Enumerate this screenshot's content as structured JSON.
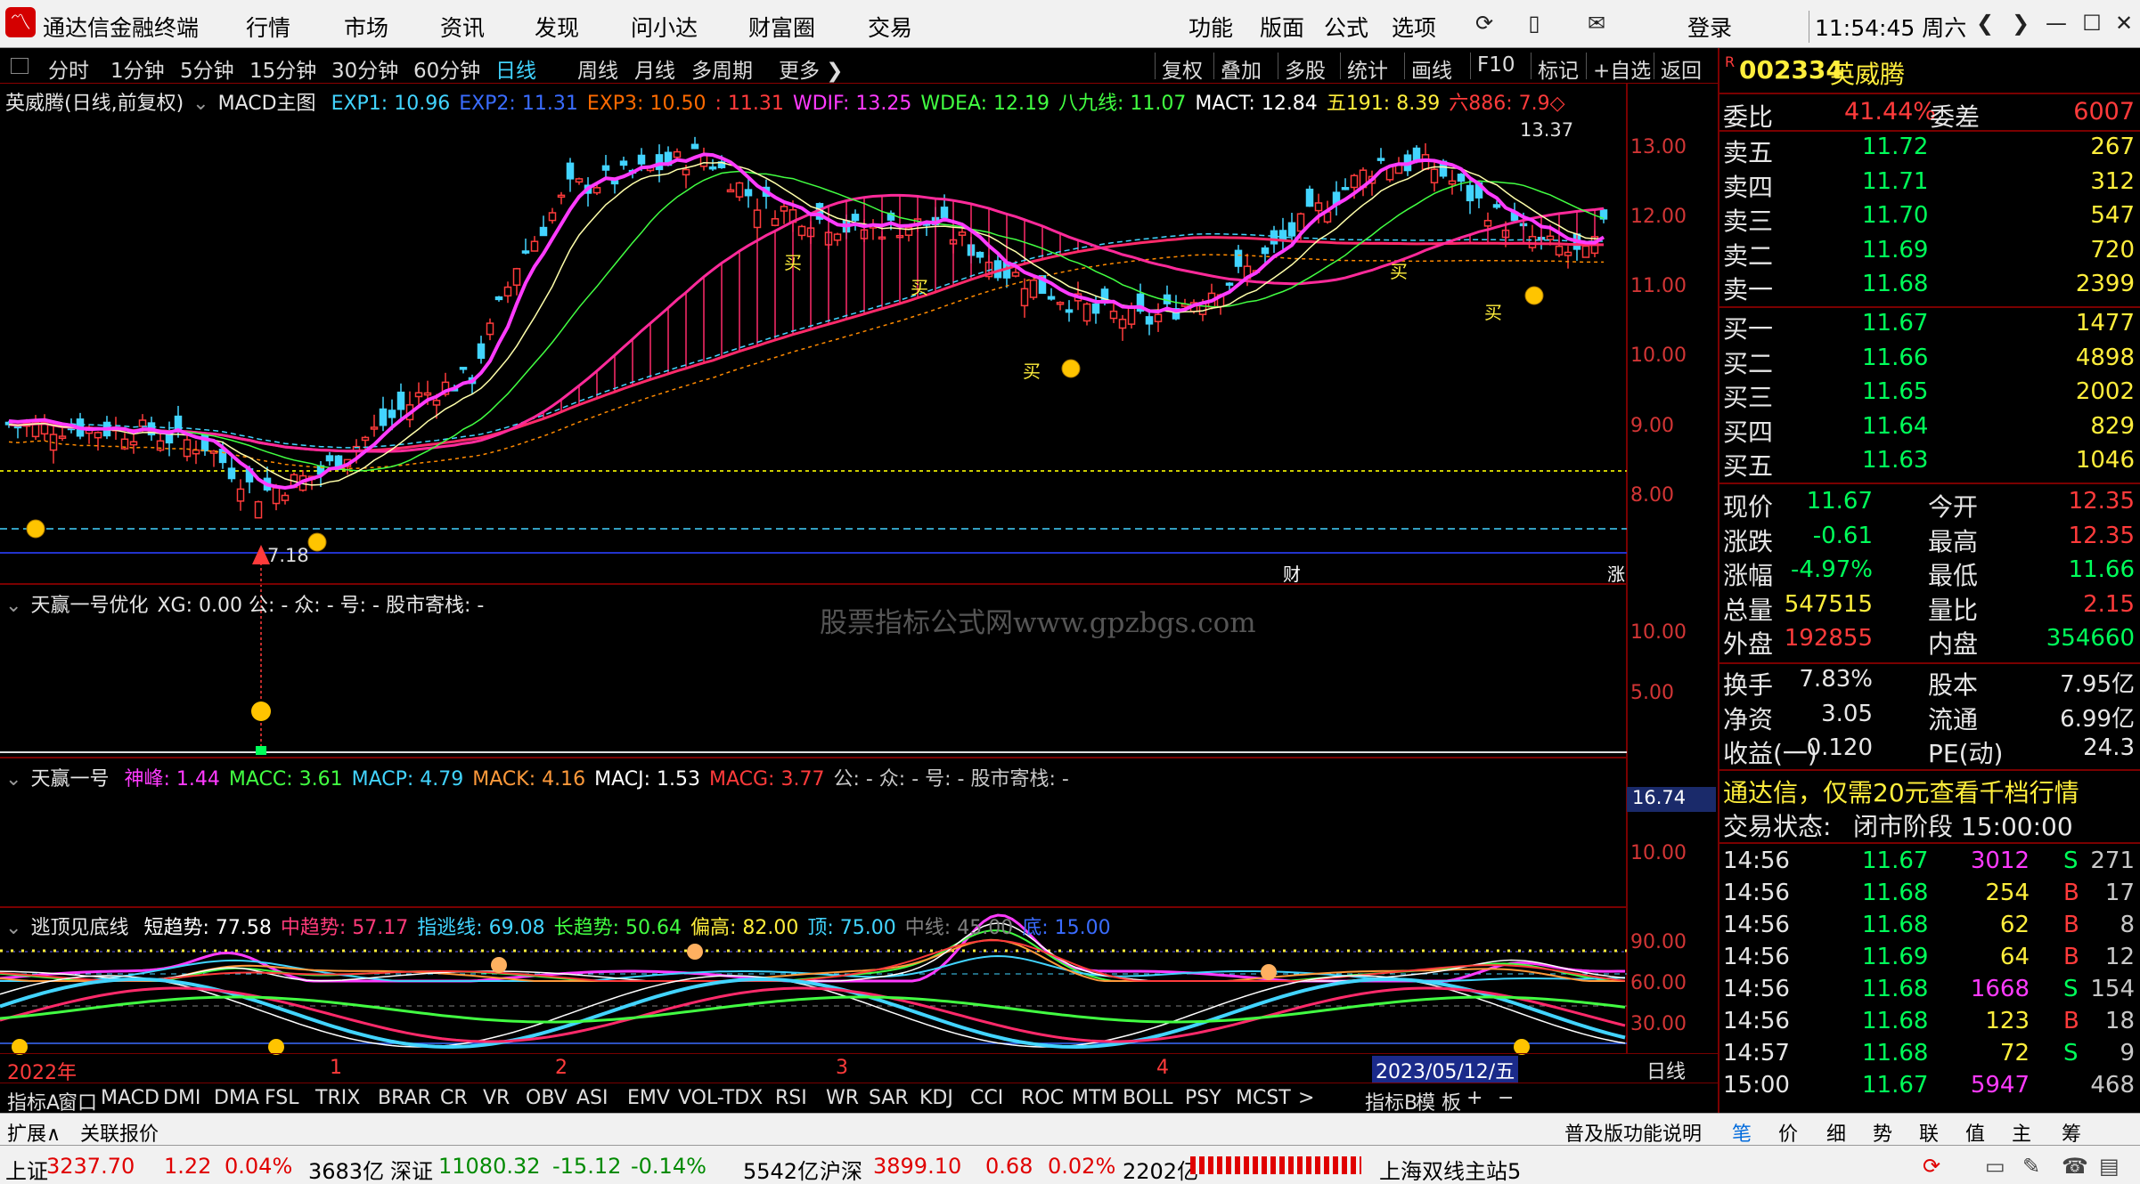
{
  "app": {
    "title": "通达信金融终端",
    "menu": [
      "行情",
      "市场",
      "资讯",
      "发现",
      "问小达",
      "财富圈",
      "交易"
    ],
    "right_menu": [
      "功能",
      "版面",
      "公式",
      "选项"
    ],
    "login": "登录",
    "clock": "11:54:45 周六"
  },
  "periods": [
    "分时",
    "1分钟",
    "5分钟",
    "15分钟",
    "30分钟",
    "60分钟",
    "日线",
    "周线",
    "月线",
    "多周期",
    "更多 ❯"
  ],
  "tools": [
    "复权",
    "叠加",
    "多股",
    "统计",
    "画线",
    "F10",
    "标记",
    "+自选",
    "返回"
  ],
  "main": {
    "title": "英威腾(日线,前复权)",
    "indicator": "MACD主图",
    "params": [
      {
        "t": "EXP1: 10.96",
        "c": "#42d4ff"
      },
      {
        "t": "EXP2: 11.31",
        "c": "#3a6cff"
      },
      {
        "t": "EXP3: 10.50",
        "c": "#ff6a00"
      },
      {
        "t": ": 11.31",
        "c": "#ff3b3b"
      },
      {
        "t": "WDIF: 13.25",
        "c": "#ff3bff"
      },
      {
        "t": "WDEA: 12.19",
        "c": "#42ff42"
      },
      {
        "t": "八九线: 11.07",
        "c": "#42ff42"
      },
      {
        "t": "MACT: 12.84",
        "c": "#ffffff"
      },
      {
        "t": "五191: 8.39",
        "c": "#ffee3c"
      },
      {
        "t": "六886: 7.9◇",
        "c": "#ff3b3b"
      }
    ],
    "y_labels": [
      "13.00",
      "12.00",
      "11.00",
      "10.00",
      "9.00",
      "8.00"
    ],
    "high_label": "13.37",
    "low_label": "7.18",
    "mark1": "财",
    "mark2": "涨",
    "buy": "买"
  },
  "sub1": {
    "title": "天赢一号优化",
    "params": "XG: 0.00 公: - 众: - 号: - 股市寄栈: -",
    "y_labels": [
      "10.00",
      "5.00"
    ],
    "watermark": "股票指标公式网www.gpzbgs.com"
  },
  "sub2": {
    "title": "天赢一号",
    "params": [
      {
        "t": "神峰: 1.44",
        "c": "#ff3bff"
      },
      {
        "t": "MACC: 3.61",
        "c": "#42ff42"
      },
      {
        "t": "MACP: 4.79",
        "c": "#42d4ff"
      },
      {
        "t": "MACK: 4.16",
        "c": "#ff9a3b"
      },
      {
        "t": "MACJ: 1.53",
        "c": "#ffffff"
      },
      {
        "t": "MACG: 3.77",
        "c": "#ff3b3b"
      },
      {
        "t": "公: - 众: - 号: - 股市寄栈: -",
        "c": "#c8c8c8"
      }
    ],
    "y_labels": [
      "16.74",
      "10.00"
    ]
  },
  "sub3": {
    "title": "逃顶见底线",
    "params": [
      {
        "t": "短趋势: 77.58",
        "c": "#ffffff"
      },
      {
        "t": "中趋势: 57.17",
        "c": "#ff3b7a"
      },
      {
        "t": "指逃线: 69.08",
        "c": "#42d4ff"
      },
      {
        "t": "长趋势: 50.64",
        "c": "#42ff42"
      },
      {
        "t": "偏高: 82.00",
        "c": "#ffee3c"
      },
      {
        "t": "顶: 75.00",
        "c": "#42d4ff"
      },
      {
        "t": "中线: 45.00",
        "c": "#808080"
      },
      {
        "t": "底: 15.00",
        "c": "#3a6cff"
      }
    ],
    "y_labels": [
      "90.00",
      "60.00",
      "30.00"
    ]
  },
  "xaxis": {
    "labels": [
      "2022年",
      "1",
      "2",
      "3",
      "4"
    ],
    "date": "2023/05/12/五",
    "period": "日线"
  },
  "tabs": [
    "指标A",
    "窗口",
    "MACD",
    "DMI",
    "DMA",
    "FSL",
    "TRIX",
    "BRAR",
    "CR",
    "VR",
    "OBV",
    "ASI",
    "EMV",
    "VOL-TDX",
    "RSI",
    "WR",
    "SAR",
    "KDJ",
    "CCI",
    "ROC",
    "MTM",
    "BOLL",
    "PSY",
    "MCST",
    ">",
    "指标B",
    "模 板",
    "+",
    "−"
  ],
  "bottom": {
    "left": [
      "扩展∧",
      "关联报价"
    ],
    "right": [
      "普及版功能说明",
      "笔",
      "价",
      "细",
      "势",
      "联",
      "值",
      "主",
      "筹"
    ]
  },
  "quote": {
    "code": "002334",
    "name": "英威腾",
    "wb_label": "委比",
    "wb": "41.44%",
    "wc_label": "委差",
    "wc": "6007",
    "asks": [
      {
        "l": "卖五",
        "p": "11.72",
        "v": "267"
      },
      {
        "l": "卖四",
        "p": "11.71",
        "v": "312"
      },
      {
        "l": "卖三",
        "p": "11.70",
        "v": "547"
      },
      {
        "l": "卖二",
        "p": "11.69",
        "v": "720"
      },
      {
        "l": "卖一",
        "p": "11.68",
        "v": "2399"
      }
    ],
    "bids": [
      {
        "l": "买一",
        "p": "11.67",
        "v": "1477"
      },
      {
        "l": "买二",
        "p": "11.66",
        "v": "4898"
      },
      {
        "l": "买三",
        "p": "11.65",
        "v": "2002"
      },
      {
        "l": "买四",
        "p": "11.64",
        "v": "829"
      },
      {
        "l": "买五",
        "p": "11.63",
        "v": "1046"
      }
    ],
    "stats": [
      {
        "l1": "现价",
        "v1": "11.67",
        "c1": "green",
        "l2": "今开",
        "v2": "12.35",
        "c2": "red"
      },
      {
        "l1": "涨跌",
        "v1": "-0.61",
        "c1": "green",
        "l2": "最高",
        "v2": "12.35",
        "c2": "red"
      },
      {
        "l1": "涨幅",
        "v1": "-4.97%",
        "c1": "green",
        "l2": "最低",
        "v2": "11.66",
        "c2": "green"
      },
      {
        "l1": "总量",
        "v1": "547515",
        "c1": "yellow",
        "l2": "量比",
        "v2": "2.15",
        "c2": "red"
      },
      {
        "l1": "外盘",
        "v1": "192855",
        "c1": "red",
        "l2": "内盘",
        "v2": "354660",
        "c2": "green"
      }
    ],
    "stats2": [
      {
        "l1": "换手",
        "v1": "7.83%",
        "l2": "股本",
        "v2": "7.95亿"
      },
      {
        "l1": "净资",
        "v1": "3.05",
        "l2": "流通",
        "v2": "6.99亿"
      },
      {
        "l1": "收益(一)",
        "v1": "0.120",
        "l2": "PE(动)",
        "v2": "24.3"
      }
    ],
    "ad": "通达信，仅需20元查看千档行情",
    "state_label": "交易状态:",
    "state": "闭市阶段 15:00:00",
    "ticks": [
      {
        "t": "14:56",
        "p": "11.67",
        "v": "3012",
        "vc": "magenta",
        "bs": "S",
        "n": "271"
      },
      {
        "t": "14:56",
        "p": "11.68",
        "v": "254",
        "vc": "yellow",
        "bs": "B",
        "n": "17"
      },
      {
        "t": "14:56",
        "p": "11.68",
        "v": "62",
        "vc": "yellow",
        "bs": "B",
        "n": "8"
      },
      {
        "t": "14:56",
        "p": "11.69",
        "v": "64",
        "vc": "yellow",
        "bs": "B",
        "n": "12"
      },
      {
        "t": "14:56",
        "p": "11.68",
        "v": "1668",
        "vc": "magenta",
        "bs": "S",
        "n": "154"
      },
      {
        "t": "14:56",
        "p": "11.68",
        "v": "123",
        "vc": "yellow",
        "bs": "B",
        "n": "18"
      },
      {
        "t": "14:57",
        "p": "11.68",
        "v": "72",
        "vc": "yellow",
        "bs": "S",
        "n": "9"
      },
      {
        "t": "15:00",
        "p": "11.67",
        "v": "5947",
        "vc": "magenta",
        "bs": "",
        "n": "468"
      }
    ]
  },
  "statusbar": {
    "items": [
      {
        "t": "上证",
        "c": "#000"
      },
      {
        "t": "3237.70",
        "c": "#e00000"
      },
      {
        "t": "1.22",
        "c": "#e00000"
      },
      {
        "t": "0.04%",
        "c": "#e00000"
      },
      {
        "t": "3683亿",
        "c": "#000"
      },
      {
        "t": "深证",
        "c": "#000"
      },
      {
        "t": "11080.32",
        "c": "#008a00"
      },
      {
        "t": "-15.12",
        "c": "#008a00"
      },
      {
        "t": "-0.14%",
        "c": "#008a00"
      },
      {
        "t": "5542亿",
        "c": "#000"
      },
      {
        "t": "沪深",
        "c": "#000"
      },
      {
        "t": "3899.10",
        "c": "#e00000"
      },
      {
        "t": "0.68",
        "c": "#e00000"
      },
      {
        "t": "0.02%",
        "c": "#e00000"
      },
      {
        "t": "2202亿",
        "c": "#000"
      }
    ],
    "server": "上海双线主站5"
  }
}
